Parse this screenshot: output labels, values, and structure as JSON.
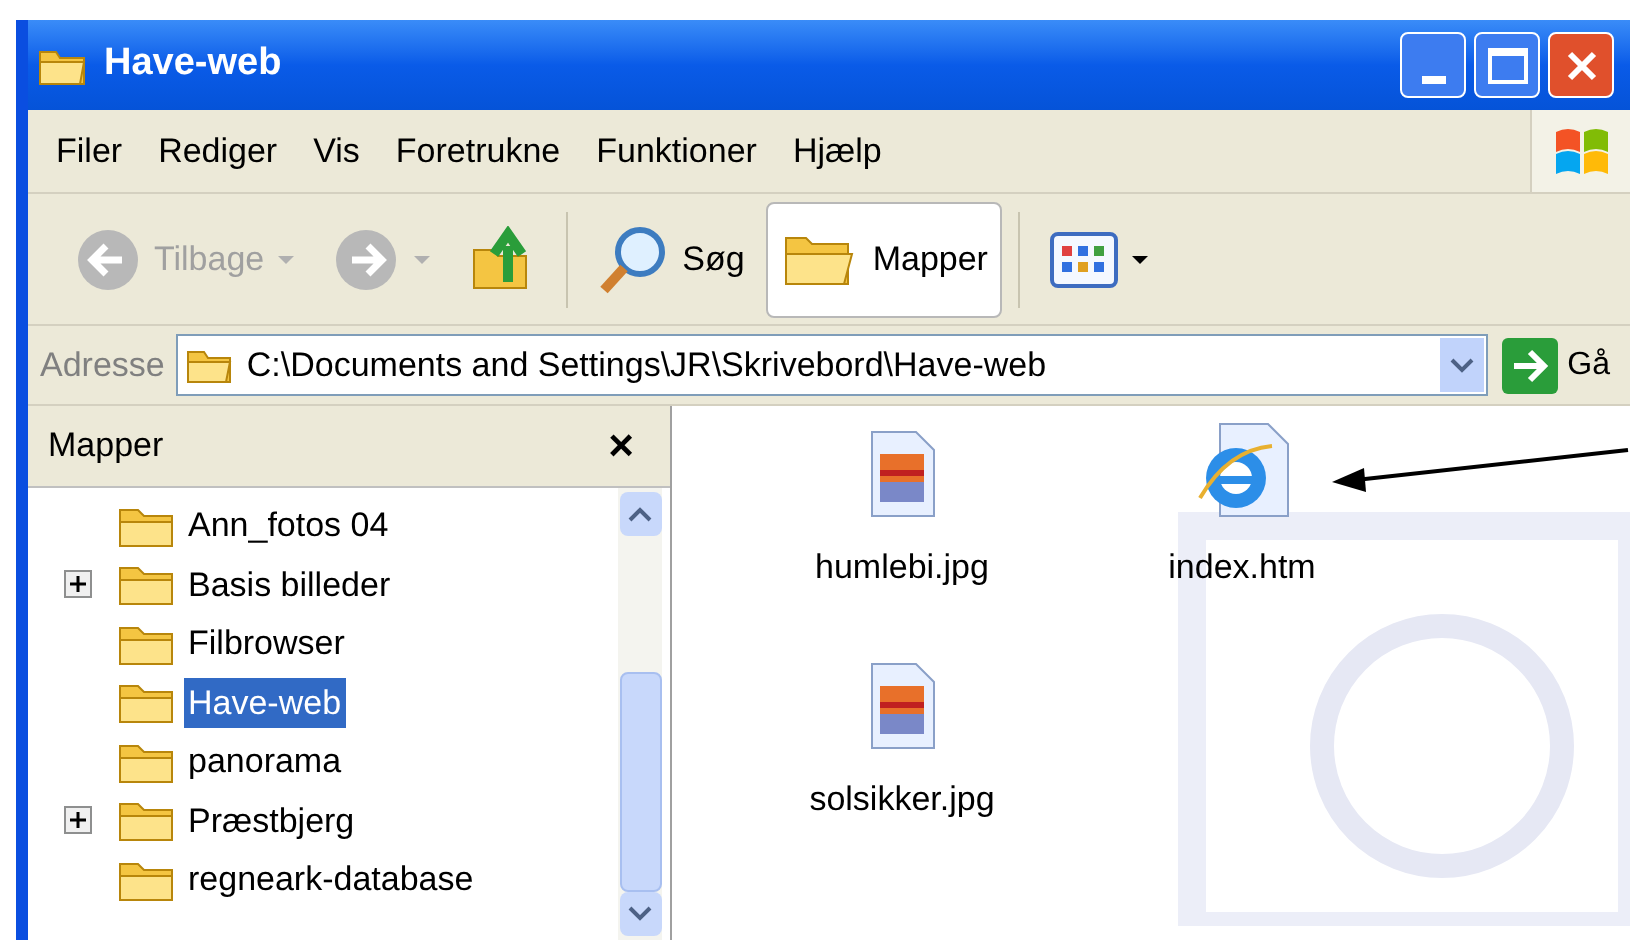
{
  "window": {
    "title": "Have-web"
  },
  "menu": [
    "Filer",
    "Rediger",
    "Vis",
    "Foretrukne",
    "Funktioner",
    "Hjælp"
  ],
  "toolbar": [
    {
      "kind": "back",
      "label": "Tilbage",
      "disabled": true
    },
    {
      "kind": "forward",
      "disabled": true
    },
    {
      "kind": "up"
    },
    {
      "kind": "search",
      "label": "Søg"
    },
    {
      "kind": "folders",
      "label": "Mapper",
      "selected": true
    },
    {
      "kind": "views"
    }
  ],
  "address": {
    "label": "Adresse",
    "value": "C:\\Documents and Settings\\JR\\Skrivebord\\Have-web",
    "go": "Gå"
  },
  "folders_pane": {
    "title": "Mapper",
    "close": "×",
    "items": [
      {
        "label": "Ann_fotos 04",
        "expandable": false,
        "selected": false
      },
      {
        "label": "Basis billeder",
        "expandable": true,
        "selected": false
      },
      {
        "label": "Filbrowser",
        "expandable": false,
        "selected": false
      },
      {
        "label": "Have-web",
        "expandable": false,
        "selected": true
      },
      {
        "label": "panorama",
        "expandable": false,
        "selected": false
      },
      {
        "label": "Præstbjerg",
        "expandable": true,
        "selected": false
      },
      {
        "label": "regneark-database",
        "expandable": false,
        "selected": false
      }
    ]
  },
  "files": [
    {
      "name": "humlebi.jpg",
      "kind": "image"
    },
    {
      "name": "index.htm",
      "kind": "html"
    },
    {
      "name": "solsikker.jpg",
      "kind": "image"
    }
  ]
}
